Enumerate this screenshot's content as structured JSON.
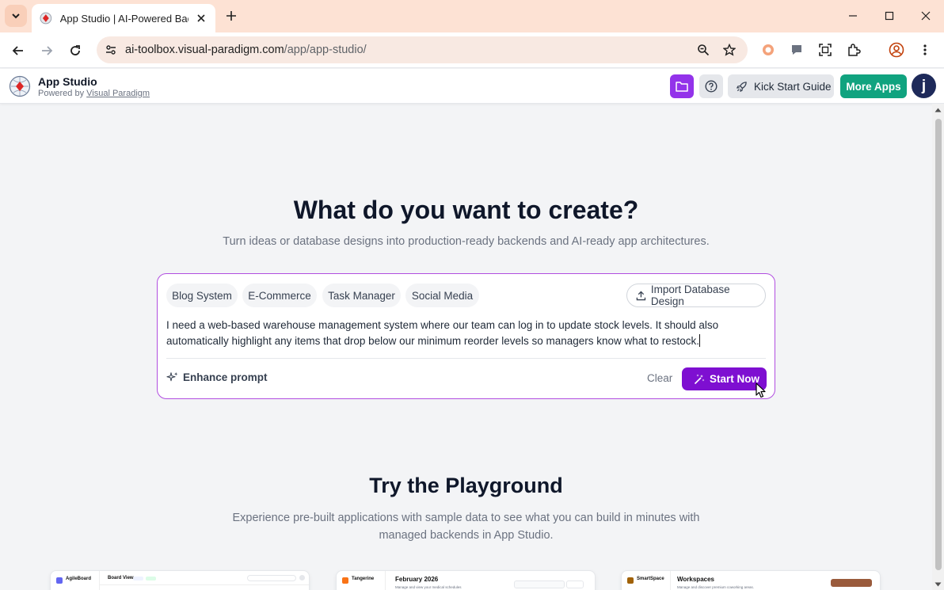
{
  "browser": {
    "tab_title": "App Studio | AI-Powered Backend",
    "url_host": "ai-toolbox.visual-paradigm.com",
    "url_path": "/app/app-studio/"
  },
  "header": {
    "app_name": "App Studio",
    "powered_by_prefix": "Powered by",
    "powered_by_link": "Visual Paradigm",
    "kick_start_label": "Kick Start Guide",
    "more_apps_label": "More Apps",
    "avatar_initial": "j"
  },
  "hero": {
    "title": "What do you want to create?",
    "subtitle": "Turn ideas or database designs into production-ready backends and AI-ready app architectures."
  },
  "prompt": {
    "chips": [
      "Blog System",
      "E-Commerce",
      "Task Manager",
      "Social Media"
    ],
    "import_label": "Import Database Design",
    "text": "I need a web-based warehouse management system where our team can log in to update stock levels. It should also automatically highlight any items that drop below our minimum reorder levels so managers know what to restock.",
    "enhance_label": "Enhance prompt",
    "clear_label": "Clear",
    "start_label": "Start Now"
  },
  "playground": {
    "title": "Try the Playground",
    "subtitle": "Experience pre-built applications with sample data to see what you can build in minutes with managed backends in App Studio.",
    "previews": [
      {
        "name": "AgileBoard",
        "heading": "Board View",
        "sub": ""
      },
      {
        "name": "Tangerine",
        "heading": "February 2026",
        "sub": "Manage and view your medical schedules"
      },
      {
        "name": "SmartSpace",
        "heading": "Workspaces",
        "sub": "Manage and discover premium coworking areas."
      }
    ]
  },
  "colors": {
    "accent": "#7e0fd1",
    "prompt_border": "#b14ee0",
    "more_apps": "#10a37f",
    "folder_button": "#9333ea",
    "tab_strip": "#fde2d4"
  }
}
